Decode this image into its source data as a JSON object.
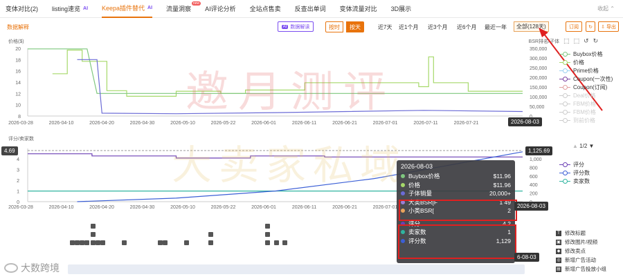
{
  "tabs": [
    {
      "label": "变体对比(2)"
    },
    {
      "label": "listing速览",
      "ai": "AI"
    },
    {
      "label": "Keepa插件替代",
      "ai": "AI",
      "active": true
    },
    {
      "label": "流量洞察",
      "badge": "new"
    },
    {
      "label": "AI评论分析"
    },
    {
      "label": "全站点售卖"
    },
    {
      "label": "反查出单词"
    },
    {
      "label": "变体流量对比"
    },
    {
      "label": "3D展示"
    }
  ],
  "collapse_label": "收起",
  "toolbar": {
    "data_explain": "数据解释",
    "ai_button": "数据解读",
    "by_hour": "按时",
    "by_day": "按天",
    "ranges": [
      "近7天",
      "近1个月",
      "近3个月",
      "近6个月",
      "最近一年",
      "全部(128天)"
    ],
    "subscribe": "订阅",
    "export": "导出"
  },
  "top_chart": {
    "left_title": "价格($)",
    "right_title": "BSR排名/子体",
    "left_ticks": [
      "20",
      "18",
      "16",
      "14",
      "12",
      "10",
      "8"
    ],
    "right_ticks": [
      "350,000",
      "300,000",
      "250,000",
      "200,000",
      "150,000",
      "100,000",
      "50,000",
      "0"
    ],
    "x_ticks": [
      "2026-03-28",
      "2026-04-10",
      "2026-04-20",
      "2026-04-30",
      "2026-05-10",
      "2026-05-22",
      "2026-06-01",
      "2026-06-11",
      "2026-06-21",
      "2026-07-01",
      "2026-07-11",
      "2026-07-21"
    ],
    "date_badge": "2026-08-03"
  },
  "bottom_chart": {
    "left_title": "评分/卖家数",
    "left_ticks": [
      "4",
      "3",
      "2",
      "1",
      "0"
    ],
    "right_ticks": [
      "1,000",
      "800",
      "600",
      "400",
      "200",
      "0"
    ],
    "x_ticks": [
      "2026-03-28",
      "2026-04-10",
      "2026-04-20",
      "2026-04-30",
      "2026-05-10",
      "2026-05-22",
      "2026-06-01",
      "2026-06-11",
      "2026-06-21",
      "2026-07-01"
    ],
    "left_badge": "4.69",
    "right_badge": "1,125.69",
    "date_badge": "2026-08-03",
    "date_badge_cut": "6-08-03"
  },
  "tooltip": {
    "date": "2026-08-03",
    "rows": [
      {
        "label": "Buybox价格",
        "value": "$11.96",
        "color": "#7fc77f"
      },
      {
        "label": "价格",
        "value": "$11.96",
        "color": "#a6d96a"
      },
      {
        "label": "子体销量",
        "value": "20,000+",
        "color": "#6b6bd6"
      },
      {
        "label": "大类BSR[F",
        "value": "1 49",
        "color": "#9a7fd6"
      },
      {
        "label": "小类BSR[",
        "value": "2",
        "color": "#e8a35c"
      }
    ],
    "rows2": [
      {
        "label": "评分",
        "value": "4.2",
        "color": "#6b3fb5"
      },
      {
        "label": "卖家数",
        "value": "1",
        "color": "#2fb5a0"
      },
      {
        "label": "评分数",
        "value": "1,129",
        "color": "#3b5fd6"
      }
    ]
  },
  "legend_top": [
    {
      "label": "Buybox价格",
      "color": "#7fc77f"
    },
    {
      "label": "价格",
      "color": "#a6d96a"
    },
    {
      "label": "Prime价格",
      "color": "#9ad0f0"
    },
    {
      "label": "Coupon(一次性)",
      "color": "#7a3fa0"
    },
    {
      "label": "Coupon(订阅)",
      "color": "#e0a0a0"
    },
    {
      "label": "Deal价格",
      "color": "#cccccc",
      "dim": true
    },
    {
      "label": "FBM价格",
      "color": "#cccccc",
      "dim": true
    },
    {
      "label": "FBM价格",
      "color": "#cccccc",
      "dim": true
    },
    {
      "label": "到前价格",
      "color": "#cccccc",
      "dim": true
    }
  ],
  "legend_pager": "1/2",
  "legend_bottom": [
    {
      "label": "评分",
      "color": "#6b3fb5"
    },
    {
      "label": "评分数",
      "color": "#3b5fd6"
    },
    {
      "label": "卖家数",
      "color": "#2fb5a0"
    }
  ],
  "events": [
    {
      "label": "修改标题",
      "icon": "T"
    },
    {
      "label": "修改图片/视频",
      "icon": "▣"
    },
    {
      "label": "修改卖点",
      "icon": "◆"
    },
    {
      "label": "新增广告活动",
      "icon": "◎"
    },
    {
      "label": "新增广告投放小组",
      "icon": "▤"
    }
  ],
  "watermark_line1": "邀月测评",
  "watermark_line2": "大卖家私域",
  "brand": "大数跨境",
  "chart_data": [
    {
      "type": "line",
      "title": "",
      "xlabel": "",
      "ylabel": "价格($)",
      "ylabel_right": "BSR排名/子体",
      "ylim": [
        8,
        20
      ],
      "ylim_right": [
        0,
        350000
      ],
      "series": [
        {
          "name": "价格",
          "axis": "left",
          "points": [
            [
              0.05,
              15.5
            ],
            [
              0.08,
              15.5
            ],
            [
              0.08,
              19.7
            ],
            [
              0.11,
              19.7
            ],
            [
              0.11,
              17.7
            ],
            [
              0.16,
              17.7
            ],
            [
              0.16,
              12.5
            ],
            [
              0.2,
              12.5
            ],
            [
              0.2,
              11.5
            ],
            [
              0.3,
              11.5
            ],
            [
              0.3,
              12.4
            ],
            [
              0.39,
              12.4
            ],
            [
              0.39,
              12.0
            ],
            [
              0.44,
              12.0
            ],
            [
              0.44,
              12.6
            ],
            [
              0.56,
              12.6
            ],
            [
              0.56,
              13.9
            ],
            [
              0.79,
              13.9
            ],
            [
              0.79,
              13.2
            ],
            [
              0.81,
              13.2
            ],
            [
              0.81,
              18.5
            ],
            [
              0.82,
              18.5
            ],
            [
              0.82,
              13.9
            ],
            [
              0.89,
              13.9
            ],
            [
              0.89,
              12.4
            ],
            [
              1.0,
              12.4
            ]
          ]
        },
        {
          "name": "Buybox价格",
          "axis": "left",
          "points": [
            [
              0.0,
              19.9
            ],
            [
              0.12,
              19.9
            ],
            [
              0.14,
              12.0
            ],
            [
              0.6,
              12.0
            ],
            [
              1.0,
              12.0
            ]
          ]
        },
        {
          "name": "子体销量",
          "axis": "left",
          "points": [
            [
              0.1,
              18
            ],
            [
              0.14,
              18
            ],
            [
              0.15,
              8.5
            ],
            [
              0.3,
              8.4
            ],
            [
              0.5,
              8.6
            ],
            [
              0.8,
              9.0
            ],
            [
              1.0,
              8.8
            ]
          ]
        }
      ]
    },
    {
      "type": "line",
      "title": "",
      "xlabel": "",
      "ylabel": "评分/卖家数",
      "ylim": [
        0,
        5
      ],
      "ylim_right": [
        0,
        1200
      ],
      "series": [
        {
          "name": "评分",
          "axis": "left",
          "points": [
            [
              0.0,
              4.5
            ],
            [
              0.13,
              4.5
            ],
            [
              0.13,
              4.3
            ],
            [
              0.3,
              4.3
            ],
            [
              0.3,
              4.1
            ],
            [
              0.45,
              4.1
            ],
            [
              0.45,
              4.3
            ],
            [
              0.6,
              4.3
            ],
            [
              0.6,
              4.2
            ],
            [
              1.0,
              4.2
            ]
          ]
        },
        {
          "name": "卖家数",
          "axis": "left",
          "points": [
            [
              0.0,
              1.0
            ],
            [
              1.0,
              1.0
            ]
          ]
        },
        {
          "name": "评分数",
          "axis": "right",
          "points": [
            [
              0.1,
              0
            ],
            [
              0.3,
              80
            ],
            [
              0.5,
              240
            ],
            [
              0.7,
              520
            ],
            [
              0.85,
              820
            ],
            [
              1.0,
              1125
            ]
          ]
        }
      ]
    }
  ]
}
